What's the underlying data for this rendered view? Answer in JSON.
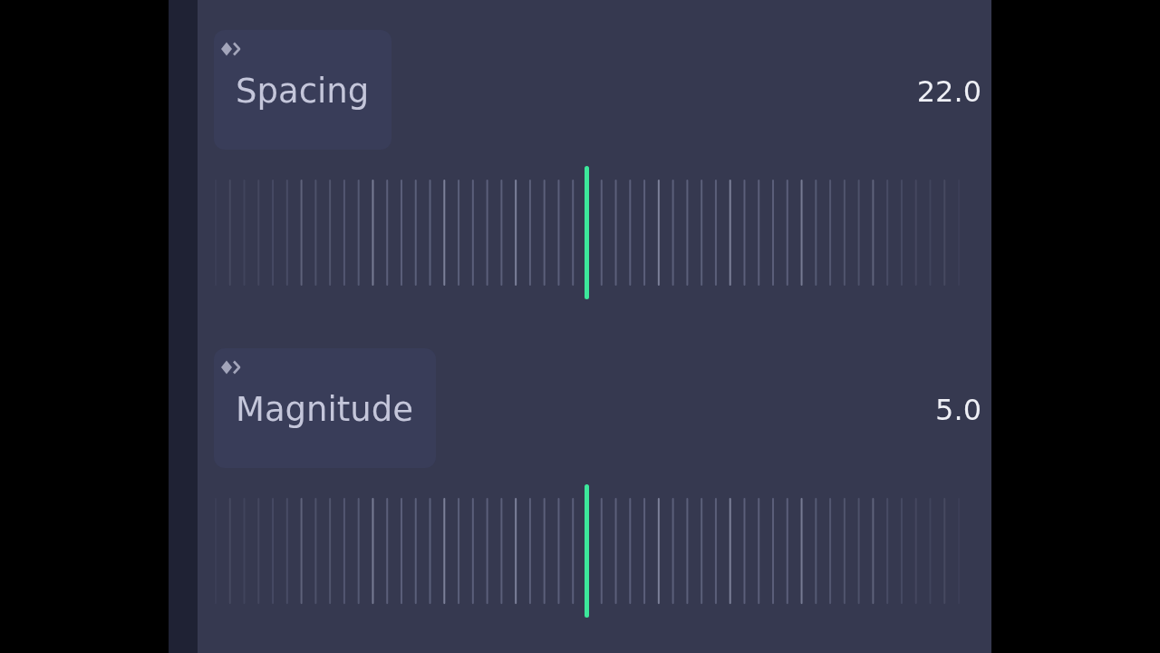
{
  "parameters": [
    {
      "label": "Spacing",
      "value": "22.0"
    },
    {
      "label": "Magnitude",
      "value": "5.0"
    }
  ]
}
